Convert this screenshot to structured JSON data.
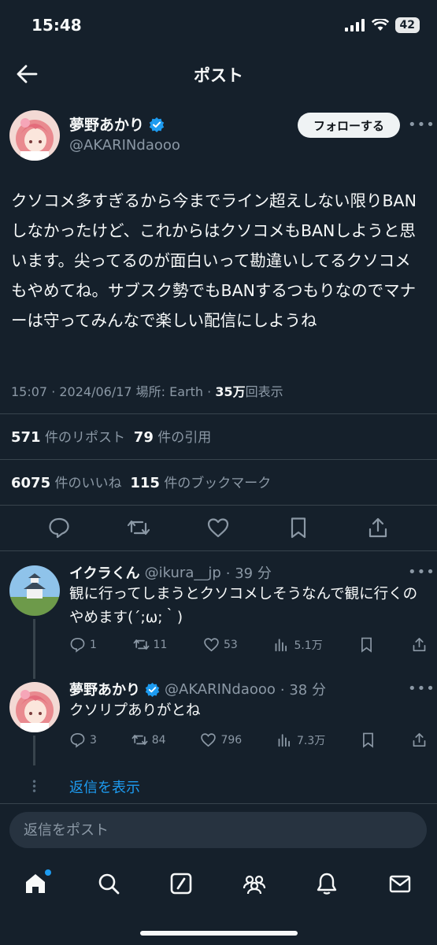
{
  "status_bar": {
    "time": "15:48",
    "battery": "42"
  },
  "header": {
    "title": "ポスト"
  },
  "post": {
    "author": {
      "name": "夢野あかり",
      "handle": "@AKARINdaooo"
    },
    "follow_label": "フォローする",
    "text": "クソコメ多すぎるから今までライン超えしない限りBANしなかったけど、これからはクソコメもBANしようと思います。尖ってるのが面白いって勘違いしてるクソコメもやめてね。サブスク勢でもBANするつもりなのでマナーは守ってみんなで楽しい配信にしようね",
    "meta": {
      "time_date": "15:07 · 2024/06/17 場所: Earth · ",
      "views": "35万",
      "views_label": "回表示"
    },
    "stats": {
      "reposts": "571",
      "reposts_label": "件のリポスト",
      "quotes": "79",
      "quotes_label": "件の引用",
      "likes": "6075",
      "likes_label": "件のいいね",
      "bookmarks": "115",
      "bookmarks_label": "件のブックマーク"
    }
  },
  "replies": [
    {
      "name": "イクラくん",
      "handle": "@ikura__jp",
      "time": "· 39 分",
      "text": "観に行ってしまうとクソコメしそうなんで観に行くのやめます(´;ω;｀)",
      "replies": "1",
      "reposts": "11",
      "likes": "53",
      "views": "5.1万"
    },
    {
      "name": "夢野あかり",
      "handle": "@AKARINdaooo",
      "time": "· 38 分",
      "text": "クソリプありがとね",
      "replies": "3",
      "reposts": "84",
      "likes": "796",
      "views": "7.3万"
    }
  ],
  "show_replies_label": "返信を表示",
  "reply_box": {
    "placeholder": "返信をポスト"
  },
  "colors": {
    "background": "#15202b",
    "accent": "#1d9bf0",
    "verified": "#1d9bf0",
    "muted": "#8b98a5"
  },
  "tabs": [
    "home-icon",
    "search-icon",
    "grok-icon",
    "communities-icon",
    "notifications-icon",
    "messages-icon"
  ]
}
